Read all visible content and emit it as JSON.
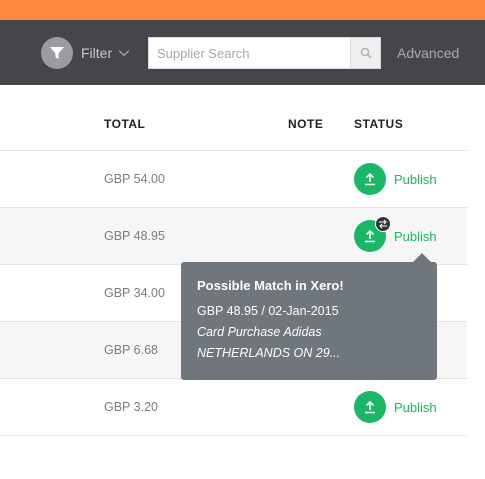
{
  "toolbar": {
    "filter_label": "Filter",
    "search_placeholder": "Supplier Search",
    "search_value": "",
    "advanced_label": "Advanced"
  },
  "table": {
    "columns": {
      "total": "TOTAL",
      "note": "NOTE",
      "status": "STATUS"
    },
    "rows": [
      {
        "total": "GBP 54.00",
        "note": "",
        "status": "Publish",
        "has_publish": true
      },
      {
        "total": "GBP 48.95",
        "note": "",
        "status": "Publish",
        "has_publish": true
      },
      {
        "total": "GBP 34.00",
        "note": "",
        "status": "",
        "has_publish": false
      },
      {
        "total": "GBP 6.68",
        "note": "",
        "status": "",
        "has_publish": false
      },
      {
        "total": "GBP 3.20",
        "note": "",
        "status": "Publish",
        "has_publish": true
      }
    ]
  },
  "tooltip": {
    "title": "Possible Match in Xero!",
    "detail": "GBP 48.95 / 02-Jan-2015",
    "description_line1": "Card Purchase Adidas",
    "description_line2": "NETHERLANDS ON 29..."
  },
  "colors": {
    "brand_orange": "#ff8a3d",
    "toolbar_bg": "#44464c",
    "publish_green": "#1ab866",
    "tooltip_bg": "#6f767c"
  }
}
